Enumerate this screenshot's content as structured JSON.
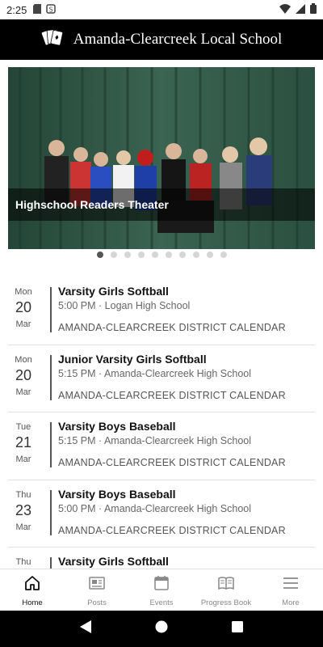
{
  "status_bar": {
    "time": "2:25"
  },
  "header": {
    "title": "Amanda-Clearcreek Local School",
    "logo_icon": "playing-cards-icon"
  },
  "carousel": {
    "caption": "Highschool Readers Theater",
    "slide_count": 10,
    "active_index": 0
  },
  "events": [
    {
      "dow": "Mon",
      "day": "20",
      "month": "Mar",
      "title": "Varsity Girls Softball",
      "time": "5:00 PM · Logan High School",
      "calendar": "AMANDA-CLEARCREEK DISTRICT CALENDAR"
    },
    {
      "dow": "Mon",
      "day": "20",
      "month": "Mar",
      "title": "Junior Varsity Girls Softball",
      "time": "5:15 PM · Amanda-Clearcreek High School",
      "calendar": "AMANDA-CLEARCREEK DISTRICT CALENDAR"
    },
    {
      "dow": "Tue",
      "day": "21",
      "month": "Mar",
      "title": "Varsity Boys Baseball",
      "time": "5:15 PM · Amanda-Clearcreek High School",
      "calendar": "AMANDA-CLEARCREEK DISTRICT CALENDAR"
    },
    {
      "dow": "Thu",
      "day": "23",
      "month": "Mar",
      "title": "Varsity Boys Baseball",
      "time": "5:00 PM · Amanda-Clearcreek High School",
      "calendar": "AMANDA-CLEARCREEK DISTRICT CALENDAR"
    },
    {
      "dow": "Thu",
      "day": "",
      "month": "",
      "title": "Varsity Girls Softball",
      "time": "",
      "calendar": ""
    }
  ],
  "bottom_nav": [
    {
      "label": "Home",
      "icon": "home-icon",
      "active": true
    },
    {
      "label": "Posts",
      "icon": "newspaper-icon",
      "active": false
    },
    {
      "label": "Events",
      "icon": "calendar-icon",
      "active": false
    },
    {
      "label": "Progress Book",
      "icon": "book-icon",
      "active": false
    },
    {
      "label": "More",
      "icon": "menu-icon",
      "active": false
    }
  ],
  "colors": {
    "header_bg": "#000000",
    "accent": "#111111",
    "inactive": "#888888"
  }
}
